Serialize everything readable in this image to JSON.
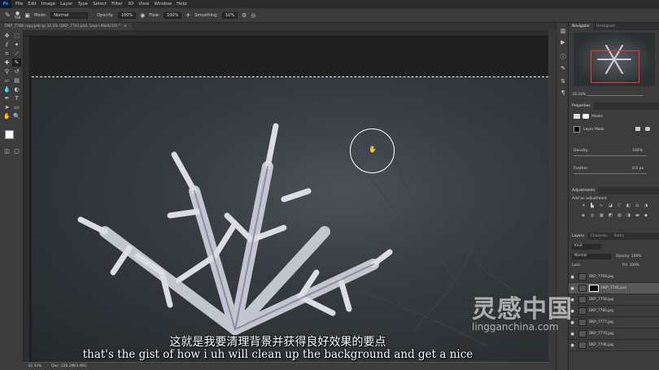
{
  "app": {
    "logo": "Ps"
  },
  "menubar": {
    "items": [
      "File",
      "Edit",
      "Image",
      "Layer",
      "Type",
      "Select",
      "Filter",
      "3D",
      "View",
      "Window",
      "Help"
    ]
  },
  "options": {
    "brush_size": "588",
    "mode_label": "Mode:",
    "mode_value": "Normal",
    "opacity_label": "Opacity:",
    "opacity_value": "100%",
    "flow_label": "Flow:",
    "flow_value": "100%",
    "smoothing_label": "Smoothing:",
    "smoothing_value": "10%"
  },
  "tabs": [
    {
      "label": "DKP_7768 copy.psb @ 33.3% (DKP_7741.psd, Layer Mask/16) *",
      "close": "×"
    }
  ],
  "status": {
    "zoom": "33.33%",
    "doc": "Doc: 126.2M/3.46G"
  },
  "panels": {
    "navigator_tabs": [
      "Navigator",
      "Histogram"
    ],
    "navigator_zoom": "33.33%",
    "properties_title": "Properties",
    "properties_masks": "Masks",
    "properties_layer_mask": "Layer Mask",
    "density_label": "Density:",
    "density_value": "100%",
    "feather_label": "Feather:",
    "feather_value": "0.0 px",
    "adjustments_title": "Adjustments",
    "adjustments_add": "Add an adjustment",
    "layers_tabs": [
      "Layers",
      "Channels",
      "Paths"
    ],
    "layers_kind": "Kind",
    "layers_blend": "Normal",
    "layers_opacity_label": "Opacity:",
    "layers_opacity_value": "100%",
    "layers_lock_label": "Lock:",
    "layers_fill_label": "Fill:",
    "layers_fill_value": "100%",
    "layers": [
      {
        "name": "DKP_7768.jpg"
      },
      {
        "name": "DKP_7741.psd"
      },
      {
        "name": "DKP_7758.jpg"
      },
      {
        "name": "DKP_7780.jpg"
      },
      {
        "name": "DKP_7777.jpg"
      },
      {
        "name": "DKP_7770.jpg"
      },
      {
        "name": "DKP_7746.jpg"
      }
    ]
  },
  "subtitles": {
    "chinese": "这就是我要清理背景并获得良好效果的要点",
    "english": "that's the gist of how i uh will clean up the background and get a nice"
  },
  "watermark": {
    "text": "灵感中国",
    "url": "lingganchina.com"
  }
}
